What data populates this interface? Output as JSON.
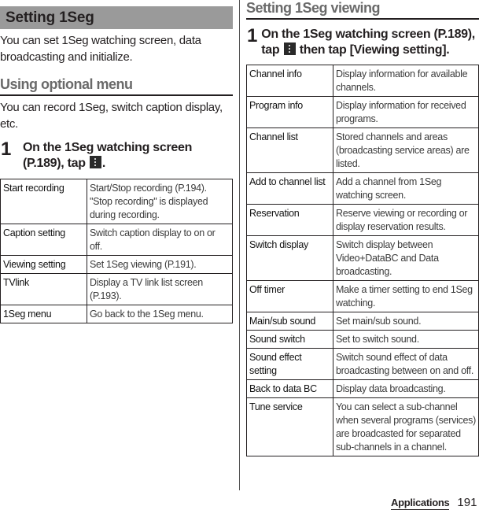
{
  "left": {
    "section_title": "Setting 1Seg",
    "intro": "You can set 1Seg watching screen, data broadcasting and initialize.",
    "subheading": "Using optional menu",
    "sub_intro": "You can record 1Seg, switch caption display, etc.",
    "step": {
      "number": "1",
      "text_before": "On the 1Seg watching screen (P.189), tap",
      "icon": "menu-icon",
      "text_after": "."
    },
    "table": [
      {
        "key": "Start recording",
        "value": "Start/Stop recording (P.194). \"Stop recording\" is displayed during recording."
      },
      {
        "key": "Caption setting",
        "value": "Switch caption display to on or off."
      },
      {
        "key": "Viewing setting",
        "value": "Set 1Seg viewing (P.191)."
      },
      {
        "key": "TVlink",
        "value": "Display a TV link list screen (P.193)."
      },
      {
        "key": "1Seg menu",
        "value": "Go back to the 1Seg menu."
      }
    ]
  },
  "right": {
    "subheading": "Setting 1Seg viewing",
    "step": {
      "number": "1",
      "text_before": "On the 1Seg watching screen (P.189), tap",
      "icon": "menu-icon",
      "text_after": "then tap [Viewing setting]."
    },
    "table": [
      {
        "key": "Channel info",
        "value": "Display information for available channels."
      },
      {
        "key": "Program info",
        "value": "Display information for received programs."
      },
      {
        "key": "Channel list",
        "value": "Stored channels and areas (broadcasting service areas) are listed."
      },
      {
        "key": "Add to channel list",
        "value": "Add a channel from 1Seg watching screen."
      },
      {
        "key": "Reservation",
        "value": "Reserve viewing or recording or display reservation results."
      },
      {
        "key": "Switch display",
        "value": "Switch display between Video+DataBC and Data broadcasting."
      },
      {
        "key": "Off timer",
        "value": "Make a timer setting to end 1Seg watching."
      },
      {
        "key": "Main/sub sound",
        "value": "Set main/sub sound."
      },
      {
        "key": "Sound switch",
        "value": "Set to switch sound."
      },
      {
        "key": "Sound effect setting",
        "value": "Switch sound effect of data broadcasting between on and off."
      },
      {
        "key": "Back to data BC",
        "value": "Display data broadcasting."
      },
      {
        "key": "Tune service",
        "value": "You can select a sub-channel when several programs (services) are broadcasted for separated sub-channels in a channel."
      }
    ]
  },
  "footer": {
    "chapter": "Applications",
    "page_number": "191"
  }
}
